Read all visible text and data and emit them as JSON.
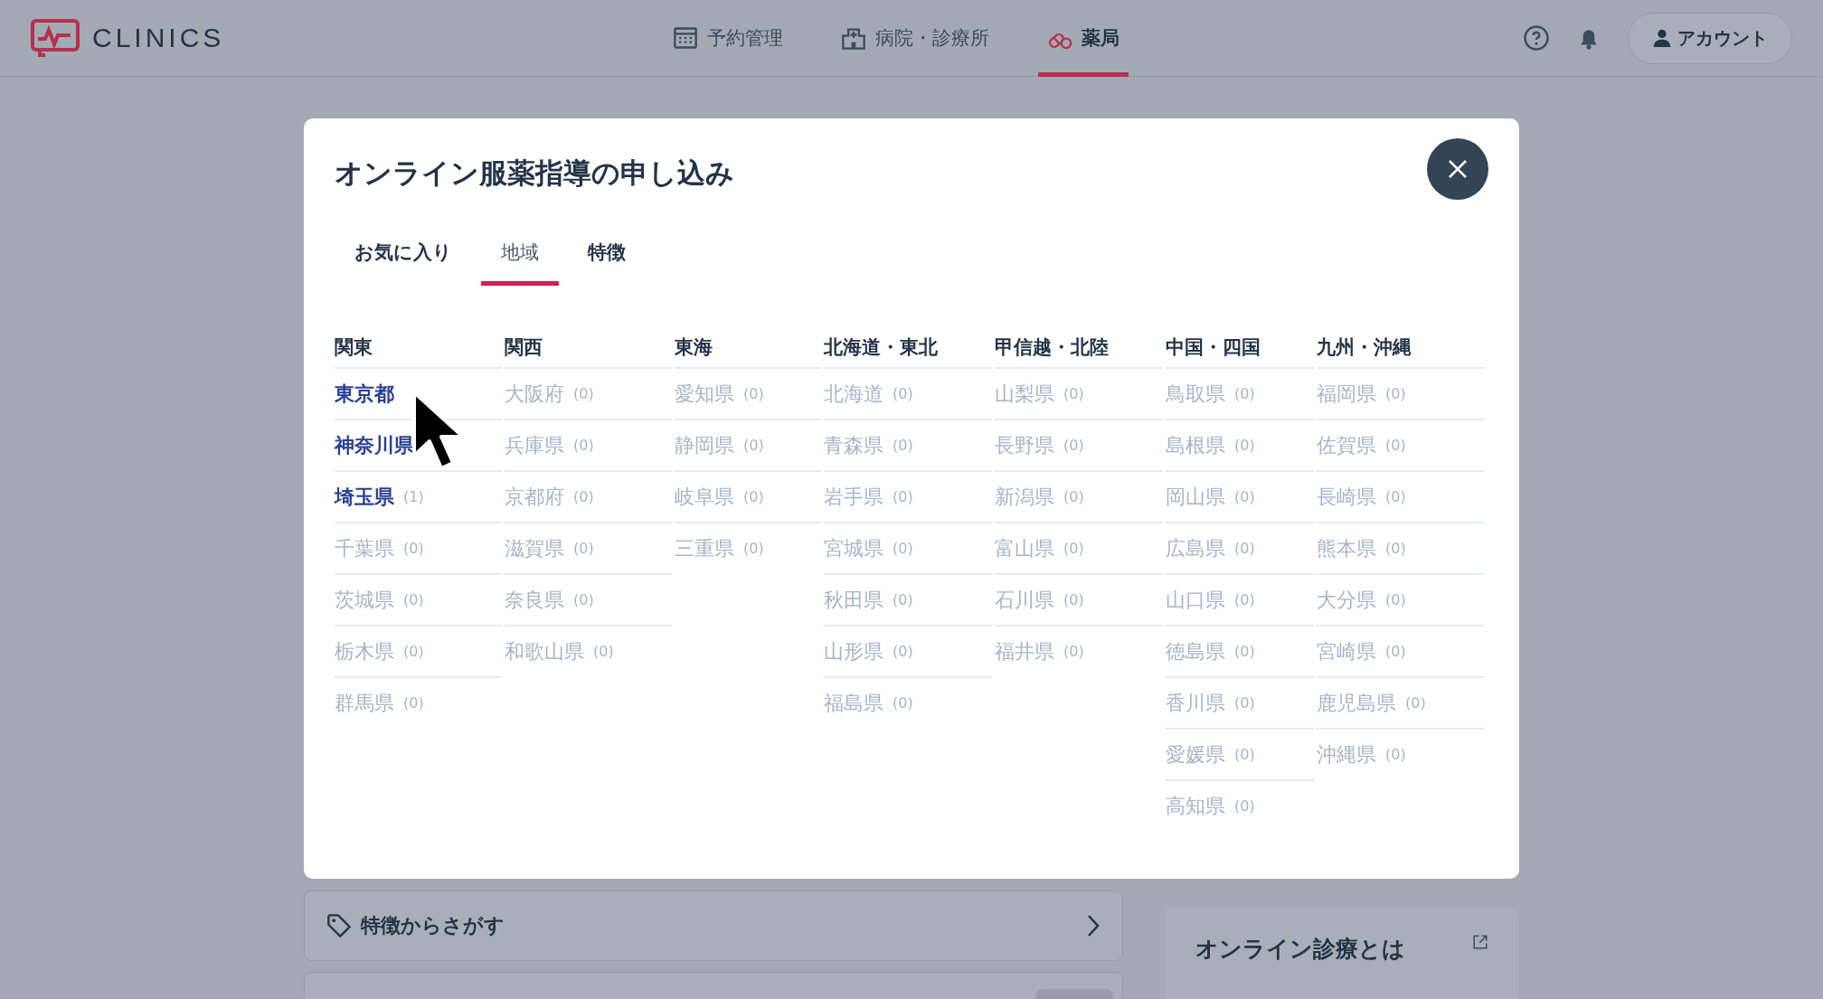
{
  "header": {
    "logo": "CLINICS",
    "nav": [
      {
        "label": "予約管理",
        "selected": false
      },
      {
        "label": "病院・診療所",
        "selected": false
      },
      {
        "label": "薬局",
        "selected": true
      }
    ],
    "account": "アカウント"
  },
  "modal": {
    "title": "オンライン服薬指導の申し込み",
    "tabs": [
      {
        "label": "お気に入り",
        "selected": false
      },
      {
        "label": "地域",
        "selected": true
      },
      {
        "label": "特徴",
        "selected": false
      }
    ],
    "regions": [
      {
        "name": "関東",
        "prefectures": [
          {
            "name": "東京都",
            "enabled": true
          },
          {
            "name": "神奈川県",
            "enabled": true
          },
          {
            "name": "埼玉県",
            "count": "(1)",
            "enabled": true
          },
          {
            "name": "千葉県",
            "count": "(0)",
            "enabled": false
          },
          {
            "name": "茨城県",
            "count": "(0)",
            "enabled": false
          },
          {
            "name": "栃木県",
            "count": "(0)",
            "enabled": false
          },
          {
            "name": "群馬県",
            "count": "(0)",
            "enabled": false
          }
        ]
      },
      {
        "name": "関西",
        "prefectures": [
          {
            "name": "大阪府",
            "count": "(0)",
            "enabled": false
          },
          {
            "name": "兵庫県",
            "count": "(0)",
            "enabled": false
          },
          {
            "name": "京都府",
            "count": "(0)",
            "enabled": false
          },
          {
            "name": "滋賀県",
            "count": "(0)",
            "enabled": false
          },
          {
            "name": "奈良県",
            "count": "(0)",
            "enabled": false
          },
          {
            "name": "和歌山県",
            "count": "(0)",
            "enabled": false
          }
        ]
      },
      {
        "name": "東海",
        "prefectures": [
          {
            "name": "愛知県",
            "count": "(0)",
            "enabled": false
          },
          {
            "name": "静岡県",
            "count": "(0)",
            "enabled": false
          },
          {
            "name": "岐阜県",
            "count": "(0)",
            "enabled": false
          },
          {
            "name": "三重県",
            "count": "(0)",
            "enabled": false
          }
        ]
      },
      {
        "name": "北海道・東北",
        "prefectures": [
          {
            "name": "北海道",
            "count": "(0)",
            "enabled": false
          },
          {
            "name": "青森県",
            "count": "(0)",
            "enabled": false
          },
          {
            "name": "岩手県",
            "count": "(0)",
            "enabled": false
          },
          {
            "name": "宮城県",
            "count": "(0)",
            "enabled": false
          },
          {
            "name": "秋田県",
            "count": "(0)",
            "enabled": false
          },
          {
            "name": "山形県",
            "count": "(0)",
            "enabled": false
          },
          {
            "name": "福島県",
            "count": "(0)",
            "enabled": false
          }
        ]
      },
      {
        "name": "甲信越・北陸",
        "prefectures": [
          {
            "name": "山梨県",
            "count": "(0)",
            "enabled": false
          },
          {
            "name": "長野県",
            "count": "(0)",
            "enabled": false
          },
          {
            "name": "新潟県",
            "count": "(0)",
            "enabled": false
          },
          {
            "name": "富山県",
            "count": "(0)",
            "enabled": false
          },
          {
            "name": "石川県",
            "count": "(0)",
            "enabled": false
          },
          {
            "name": "福井県",
            "count": "(0)",
            "enabled": false
          }
        ]
      },
      {
        "name": "中国・四国",
        "prefectures": [
          {
            "name": "鳥取県",
            "count": "(0)",
            "enabled": false
          },
          {
            "name": "島根県",
            "count": "(0)",
            "enabled": false
          },
          {
            "name": "岡山県",
            "count": "(0)",
            "enabled": false
          },
          {
            "name": "広島県",
            "count": "(0)",
            "enabled": false
          },
          {
            "name": "山口県",
            "count": "(0)",
            "enabled": false
          },
          {
            "name": "徳島県",
            "count": "(0)",
            "enabled": false
          },
          {
            "name": "香川県",
            "count": "(0)",
            "enabled": false
          },
          {
            "name": "愛媛県",
            "count": "(0)",
            "enabled": false
          },
          {
            "name": "高知県",
            "count": "(0)",
            "enabled": false
          }
        ]
      },
      {
        "name": "九州・沖縄",
        "prefectures": [
          {
            "name": "福岡県",
            "count": "(0)",
            "enabled": false
          },
          {
            "name": "佐賀県",
            "count": "(0)",
            "enabled": false
          },
          {
            "name": "長崎県",
            "count": "(0)",
            "enabled": false
          },
          {
            "name": "熊本県",
            "count": "(0)",
            "enabled": false
          },
          {
            "name": "大分県",
            "count": "(0)",
            "enabled": false
          },
          {
            "name": "宮崎県",
            "count": "(0)",
            "enabled": false
          },
          {
            "name": "鹿児島県",
            "count": "(0)",
            "enabled": false
          },
          {
            "name": "沖縄県",
            "count": "(0)",
            "enabled": false
          }
        ]
      }
    ]
  },
  "background": {
    "feature_search": "特徴からさがす",
    "about_card": "オンライン診療とは"
  }
}
